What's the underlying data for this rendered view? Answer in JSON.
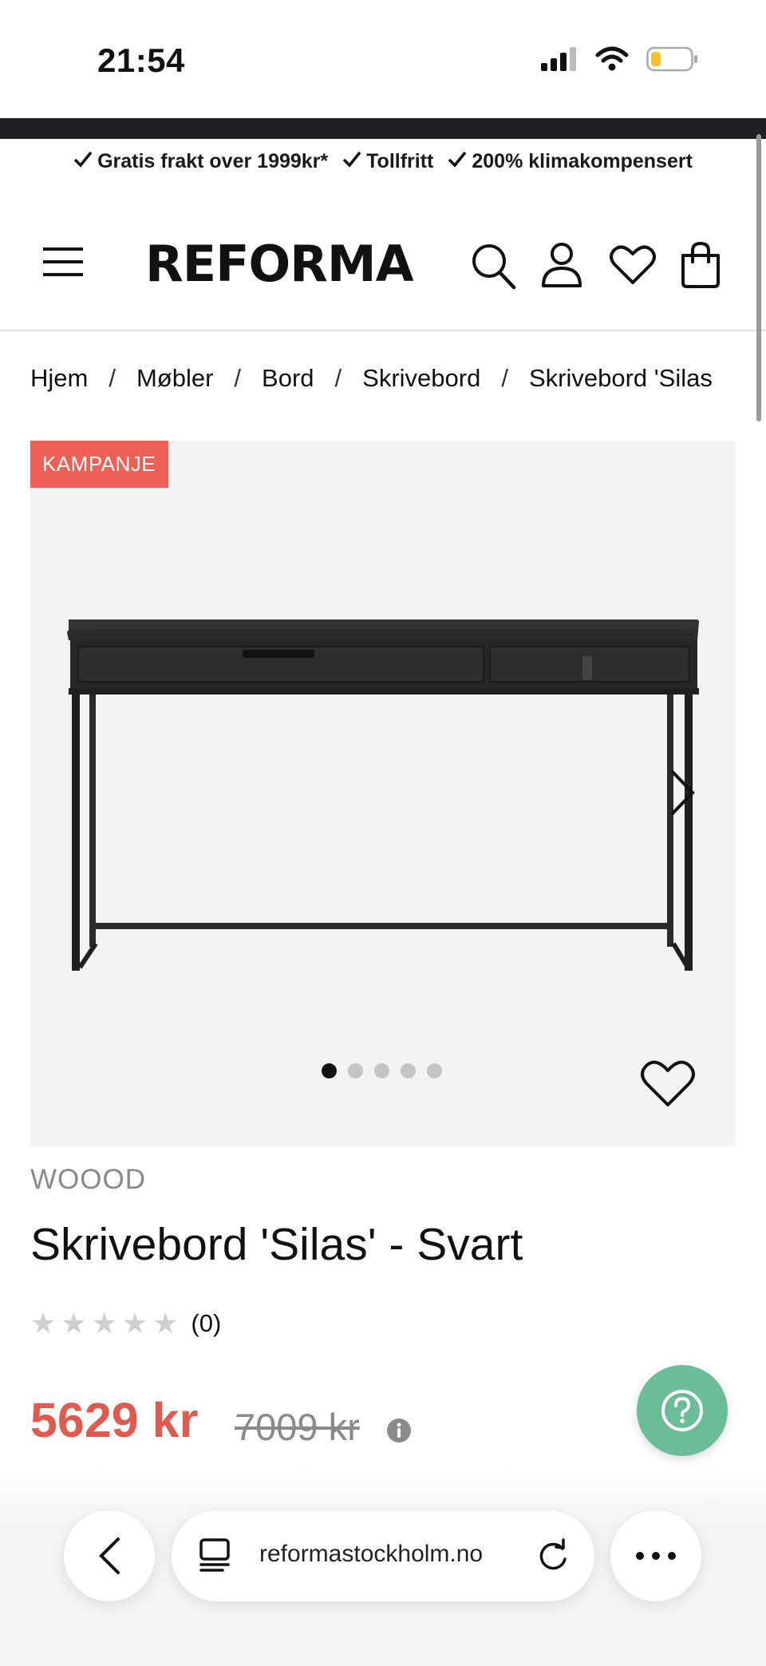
{
  "status_bar": {
    "time": "21:54",
    "icons": [
      "signal-icon",
      "wifi-icon",
      "battery-icon"
    ]
  },
  "usp_bar": {
    "items": [
      "Gratis frakt over 1999kr*",
      "Tollfritt",
      "200% klimakompensert"
    ]
  },
  "header": {
    "logo": "REFORMA",
    "icons": [
      "menu-icon",
      "search-icon",
      "account-icon",
      "wishlist-icon",
      "cart-icon"
    ]
  },
  "breadcrumb": {
    "items": [
      "Hjem",
      "Møbler",
      "Bord",
      "Skrivebord",
      "Skrivebord 'Silas"
    ],
    "separator": "/"
  },
  "gallery": {
    "badge": "KAMPANJE",
    "dots_total": 5,
    "active_dot": 1
  },
  "product": {
    "brand": "WOOOD",
    "title": "Skrivebord 'Silas' - Svart",
    "rating_stars": 0,
    "rating_count": "(0)",
    "price": "5629 kr",
    "old_price": "7009 kr"
  },
  "browser": {
    "url": "reformastockholm.no"
  },
  "colors": {
    "sale_red": "#ee5f55",
    "price_red": "#e05a50",
    "help_green": "#6bbd98",
    "dark_strip": "#1f2124"
  }
}
